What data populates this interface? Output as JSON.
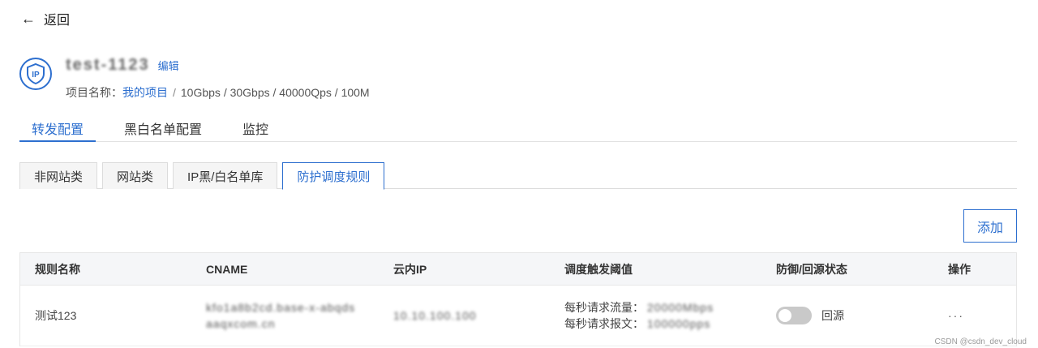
{
  "nav": {
    "back_label": "返回"
  },
  "header": {
    "instance_name": "test-1123",
    "edit_label": "编辑",
    "project_label": "项目名称：",
    "project_name": "我的项目",
    "spec_sep": "/",
    "spec": "10Gbps / 30Gbps / 40000Qps / 100M"
  },
  "main_tabs": [
    {
      "label": "转发配置",
      "active": true
    },
    {
      "label": "黑白名单配置",
      "active": false
    },
    {
      "label": "监控",
      "active": false
    }
  ],
  "sub_tabs": [
    {
      "label": "非网站类",
      "active": false
    },
    {
      "label": "网站类",
      "active": false
    },
    {
      "label": "IP黑/白名单库",
      "active": false
    },
    {
      "label": "防护调度规则",
      "active": true
    }
  ],
  "toolbar": {
    "add_label": "添加"
  },
  "table": {
    "columns": [
      "规则名称",
      "CNAME",
      "云内IP",
      "调度触发阈值",
      "防御/回源状态",
      "操作"
    ],
    "rows": [
      {
        "name": "测试123",
        "cname_line1": "kfo1a8b2cd.base-x-abqds",
        "cname_line2": "aaqxcom.cn",
        "ip": "10.10.100.100",
        "traffic_label": "每秒请求流量：",
        "traffic_value": "20000Mbps",
        "packet_label": "每秒请求报文：",
        "packet_value": "100000pps",
        "status_label": "回源",
        "status_on": false,
        "action": "···"
      }
    ]
  },
  "watermark": "CSDN @csdn_dev_cloud",
  "colors": {
    "accent": "#2d6fcf",
    "toggle_off": "#c9c9c9"
  }
}
